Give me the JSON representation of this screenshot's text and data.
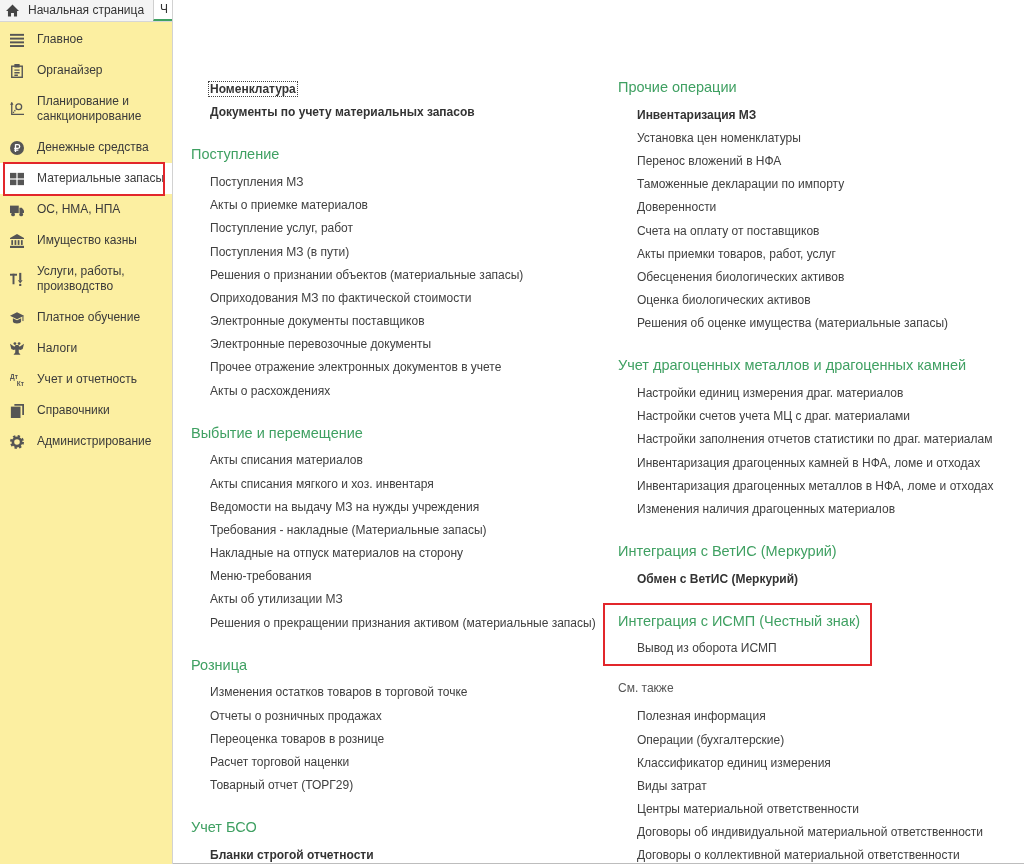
{
  "tabs": [
    {
      "kind": "home",
      "label": "Начальная страница",
      "selected": false
    },
    {
      "kind": "page",
      "label": "Ч",
      "selected": true
    }
  ],
  "sidebar": {
    "items": [
      {
        "label": "Главное",
        "selected": false,
        "highlighted": false
      },
      {
        "label": "Органайзер",
        "selected": false,
        "highlighted": false
      },
      {
        "label": "Планирование и санкционирование",
        "selected": false,
        "highlighted": false
      },
      {
        "label": "Денежные средства",
        "selected": false,
        "highlighted": false
      },
      {
        "label": "Материальные запасы",
        "selected": true,
        "highlighted": true
      },
      {
        "label": "ОС, НМА, НПА",
        "selected": false,
        "highlighted": false
      },
      {
        "label": "Имущество казны",
        "selected": false,
        "highlighted": false
      },
      {
        "label": "Услуги, работы, производство",
        "selected": false,
        "highlighted": false
      },
      {
        "label": "Платное обучение",
        "selected": false,
        "highlighted": false
      },
      {
        "label": "Налоги",
        "selected": false,
        "highlighted": false
      },
      {
        "label": "Учет и отчетность",
        "selected": false,
        "highlighted": false,
        "icon_text": [
          "Дт",
          "Кт"
        ]
      },
      {
        "label": "Справочники",
        "selected": false,
        "highlighted": false
      },
      {
        "label": "Администрирование",
        "selected": false,
        "highlighted": false
      }
    ]
  },
  "content": {
    "columns": [
      {
        "groups": [
          {
            "kind": "plain",
            "highlighted": false,
            "links": [
              {
                "text": "Номенклатура",
                "important": true,
                "focused": true
              },
              {
                "text": "Документы по учету материальных запасов",
                "important": true,
                "focused": false
              }
            ]
          },
          {
            "kind": "section",
            "title": "Поступление",
            "highlighted": false,
            "links": [
              {
                "text": "Поступления МЗ",
                "important": false
              },
              {
                "text": "Акты о приемке материалов",
                "important": false
              },
              {
                "text": "Поступление услуг, работ",
                "important": false
              },
              {
                "text": "Поступления МЗ (в пути)",
                "important": false
              },
              {
                "text": "Решения о признании объектов (материальные запасы)",
                "important": false
              },
              {
                "text": "Оприходования МЗ по фактической стоимости",
                "important": false
              },
              {
                "text": "Электронные документы поставщиков",
                "important": false
              },
              {
                "text": "Электронные перевозочные документы",
                "important": false
              },
              {
                "text": "Прочее отражение электронных документов в учете",
                "important": false
              },
              {
                "text": "Акты о расхождениях",
                "important": false
              }
            ]
          },
          {
            "kind": "section",
            "title": "Выбытие и перемещение",
            "highlighted": false,
            "links": [
              {
                "text": "Акты списания материалов",
                "important": false
              },
              {
                "text": "Акты списания мягкого и хоз. инвентаря",
                "important": false
              },
              {
                "text": "Ведомости на выдачу МЗ на нужды учреждения",
                "important": false
              },
              {
                "text": "Требования - накладные (Материальные запасы)",
                "important": false
              },
              {
                "text": "Накладные на отпуск материалов на сторону",
                "important": false
              },
              {
                "text": "Меню-требования",
                "important": false
              },
              {
                "text": "Акты об утилизации МЗ",
                "important": false
              },
              {
                "text": "Решения о прекращении признания активом (материальные запасы)",
                "important": false
              }
            ]
          },
          {
            "kind": "section",
            "title": "Розница",
            "highlighted": false,
            "links": [
              {
                "text": "Изменения остатков товаров в торговой точке",
                "important": false
              },
              {
                "text": "Отчеты о розничных продажах",
                "important": false
              },
              {
                "text": "Переоценка товаров в рознице",
                "important": false
              },
              {
                "text": "Расчет торговой наценки",
                "important": false
              },
              {
                "text": "Товарный отчет (ТОРГ29)",
                "important": false
              }
            ]
          },
          {
            "kind": "section",
            "title": "Учет БСО",
            "highlighted": false,
            "links": [
              {
                "text": "Бланки строгой отчетности",
                "important": true
              }
            ]
          }
        ]
      },
      {
        "groups": [
          {
            "kind": "section",
            "title": "Прочие операции",
            "highlighted": false,
            "links": [
              {
                "text": "Инвентаризация МЗ",
                "important": true
              },
              {
                "text": "Установка цен номенклатуры",
                "important": false
              },
              {
                "text": "Перенос вложений в НФА",
                "important": false
              },
              {
                "text": "Таможенные декларации по импорту",
                "important": false
              },
              {
                "text": "Доверенности",
                "important": false
              },
              {
                "text": "Счета на оплату от поставщиков",
                "important": false
              },
              {
                "text": "Акты приемки товаров, работ, услуг",
                "important": false
              },
              {
                "text": "Обесценения биологических активов",
                "important": false
              },
              {
                "text": "Оценка биологических активов",
                "important": false
              },
              {
                "text": "Решения об оценке имущества (материальные запасы)",
                "important": false
              }
            ]
          },
          {
            "kind": "section",
            "title": "Учет драгоценных металлов и драгоценных камней",
            "highlighted": false,
            "links": [
              {
                "text": "Настройки единиц измерения драг. материалов",
                "important": false
              },
              {
                "text": "Настройки счетов учета МЦ с драг. материалами",
                "important": false
              },
              {
                "text": "Настройки заполнения отчетов статистики по драг. материалам",
                "important": false
              },
              {
                "text": "Инвентаризация драгоценных камней в НФА, ломе и отходах",
                "important": false
              },
              {
                "text": "Инвентаризация драгоценных металлов в НФА, ломе и отходах",
                "important": false
              },
              {
                "text": "Изменения наличия драгоценных материалов",
                "important": false
              }
            ]
          },
          {
            "kind": "section",
            "title": "Интеграция с ВетИС (Меркурий)",
            "highlighted": false,
            "links": [
              {
                "text": "Обмен с ВетИС (Меркурий)",
                "important": true
              }
            ]
          },
          {
            "kind": "section",
            "title": "Интеграция с ИСМП (Честный знак)",
            "highlighted": true,
            "links": [
              {
                "text": "Вывод из оборота ИСМП",
                "important": false
              }
            ]
          },
          {
            "kind": "see_also",
            "title": "См. также",
            "highlighted": false,
            "links": [
              {
                "text": "Полезная информация",
                "important": false
              },
              {
                "text": "Операции (бухгалтерские)",
                "important": false
              },
              {
                "text": "Классификатор единиц измерения",
                "important": false
              },
              {
                "text": "Виды затрат",
                "important": false
              },
              {
                "text": "Центры материальной ответственности",
                "important": false
              },
              {
                "text": "Договоры об индивидуальной материальной ответственности",
                "important": false
              },
              {
                "text": "Договоры о коллективной материальной ответственности",
                "important": false
              }
            ]
          }
        ]
      }
    ]
  }
}
